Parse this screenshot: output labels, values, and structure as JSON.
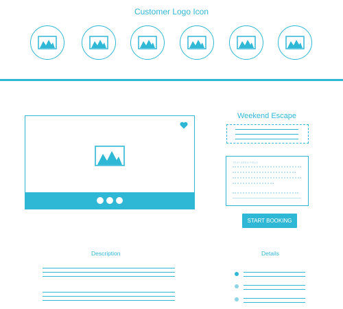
{
  "header": {
    "title": "Customer Logo Icon",
    "logos": [
      "image-icon",
      "image-icon",
      "image-icon",
      "image-icon",
      "image-icon",
      "image-icon"
    ]
  },
  "card": {
    "title": "Weekend Escape",
    "text_field_label": "TEXT AREA FIELD",
    "button_label": "START BOOKING"
  },
  "sections": {
    "description_title": "Description",
    "details_title": "Details"
  },
  "icons": {
    "media": "image-icon",
    "favorite": "heart-icon",
    "pager": "dots-indicator"
  },
  "colors": {
    "accent": "#2fb7d6",
    "background": "#ffffff"
  }
}
